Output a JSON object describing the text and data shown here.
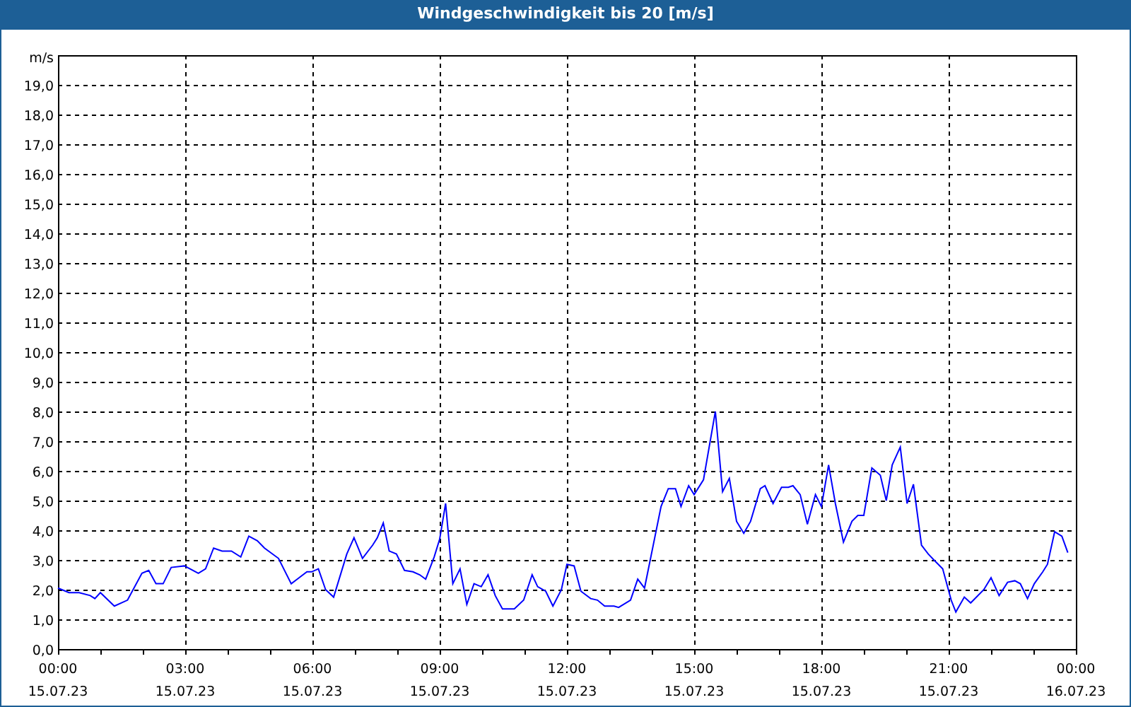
{
  "window": {
    "title": "Windgeschwindigkeit bis 20 [m/s]"
  },
  "chart": {
    "x_axis_dates": [
      "15.07.23",
      "15.07.23",
      "15.07.23",
      "15.07.23",
      "15.07.23",
      "15.07.23",
      "15.07.23",
      "15.07.23",
      "16.07.23"
    ],
    "chart_data": {
      "type": "line",
      "grid": true,
      "ylabel": "m/s",
      "xlim": [
        0,
        24
      ],
      "ylim": [
        0,
        20
      ],
      "yticks": [
        {
          "value": 0,
          "label": "0,0"
        },
        {
          "value": 1,
          "label": "1,0"
        },
        {
          "value": 2,
          "label": "2,0"
        },
        {
          "value": 3,
          "label": "3,0"
        },
        {
          "value": 4,
          "label": "4,0"
        },
        {
          "value": 5,
          "label": "5,0"
        },
        {
          "value": 6,
          "label": "6,0"
        },
        {
          "value": 7,
          "label": "7,0"
        },
        {
          "value": 8,
          "label": "8,0"
        },
        {
          "value": 9,
          "label": "9,0"
        },
        {
          "value": 10,
          "label": "10,0"
        },
        {
          "value": 11,
          "label": "11,0"
        },
        {
          "value": 12,
          "label": "12,0"
        },
        {
          "value": 13,
          "label": "13,0"
        },
        {
          "value": 14,
          "label": "14,0"
        },
        {
          "value": 15,
          "label": "15,0"
        },
        {
          "value": 16,
          "label": "16,0"
        },
        {
          "value": 17,
          "label": "17,0"
        },
        {
          "value": 18,
          "label": "18,0"
        },
        {
          "value": 19,
          "label": "19,0"
        }
      ],
      "xticks": [
        {
          "value": 0,
          "label": "00:00"
        },
        {
          "value": 3,
          "label": "03:00"
        },
        {
          "value": 6,
          "label": "06:00"
        },
        {
          "value": 9,
          "label": "09:00"
        },
        {
          "value": 12,
          "label": "12:00"
        },
        {
          "value": 15,
          "label": "15:00"
        },
        {
          "value": 18,
          "label": "18:00"
        },
        {
          "value": 21,
          "label": "21:00"
        },
        {
          "value": 24,
          "label": "00:00"
        }
      ],
      "x": [
        0,
        0.26,
        0.5,
        0.76,
        0.87,
        1.0,
        1.33,
        1.64,
        1.98,
        2.14,
        2.31,
        2.48,
        2.67,
        2.98,
        3.31,
        3.48,
        3.67,
        3.87,
        4.09,
        4.31,
        4.5,
        4.7,
        4.87,
        5.2,
        5.5,
        5.64,
        5.87,
        5.98,
        6.14,
        6.31,
        6.5,
        6.81,
        6.98,
        7.18,
        7.42,
        7.53,
        7.67,
        7.81,
        7.98,
        8.17,
        8.37,
        8.53,
        8.67,
        8.87,
        9.0,
        9.14,
        9.31,
        9.48,
        9.64,
        9.81,
        9.98,
        10.14,
        10.31,
        10.48,
        10.76,
        10.98,
        11.18,
        11.31,
        11.5,
        11.67,
        11.87,
        12,
        12.17,
        12.33,
        12.56,
        12.72,
        12.89,
        13.11,
        13.22,
        13.5,
        13.67,
        13.83,
        14.22,
        14.39,
        14.56,
        14.69,
        14.87,
        15,
        15.22,
        15.5,
        15.67,
        15.83,
        16,
        16.17,
        16.33,
        16.56,
        16.67,
        16.86,
        17.06,
        17.22,
        17.33,
        17.5,
        17.67,
        17.86,
        18,
        18.17,
        18.33,
        18.52,
        18.72,
        18.86,
        19,
        19.19,
        19.39,
        19.53,
        19.67,
        19.86,
        20.02,
        20.17,
        20.36,
        20.52,
        20.69,
        20.86,
        21.06,
        21.17,
        21.37,
        21.52,
        21.83,
        22,
        22.19,
        22.39,
        22.56,
        22.69,
        22.86,
        23.02,
        23.22,
        23.33,
        23.5,
        23.67,
        23.81
      ],
      "series": [
        {
          "color": "#0000ff",
          "values": [
            2.05,
            1.9,
            1.9,
            1.8,
            1.7,
            1.9,
            1.45,
            1.65,
            2.55,
            2.65,
            2.2,
            2.2,
            2.75,
            2.8,
            2.55,
            2.7,
            3.4,
            3.3,
            3.3,
            3.1,
            3.8,
            3.65,
            3.4,
            3.05,
            2.2,
            2.35,
            2.6,
            2.6,
            2.7,
            2.0,
            1.75,
            3.2,
            3.75,
            3.05,
            3.5,
            3.75,
            4.25,
            3.3,
            3.2,
            2.65,
            2.6,
            2.5,
            2.35,
            3.1,
            3.7,
            4.9,
            2.2,
            2.7,
            1.5,
            2.2,
            2.1,
            2.5,
            1.8,
            1.35,
            1.35,
            1.65,
            2.5,
            2.1,
            1.95,
            1.45,
            2.0,
            2.85,
            2.8,
            1.95,
            1.7,
            1.65,
            1.45,
            1.45,
            1.4,
            1.65,
            2.35,
            2.05,
            4.8,
            5.4,
            5.4,
            4.8,
            5.5,
            5.2,
            5.7,
            8.0,
            5.3,
            5.75,
            4.3,
            3.9,
            4.3,
            5.4,
            5.5,
            4.9,
            5.45,
            5.45,
            5.5,
            5.2,
            4.2,
            5.2,
            4.8,
            6.2,
            4.9,
            3.6,
            4.3,
            4.5,
            4.5,
            6.1,
            5.85,
            5.0,
            6.2,
            6.8,
            4.9,
            5.55,
            3.5,
            3.2,
            2.95,
            2.7,
            1.65,
            1.25,
            1.75,
            1.55,
            2.0,
            2.4,
            1.8,
            2.25,
            2.3,
            2.2,
            1.7,
            2.2,
            2.6,
            2.85,
            3.95,
            3.8,
            3.25
          ]
        }
      ]
    }
  }
}
